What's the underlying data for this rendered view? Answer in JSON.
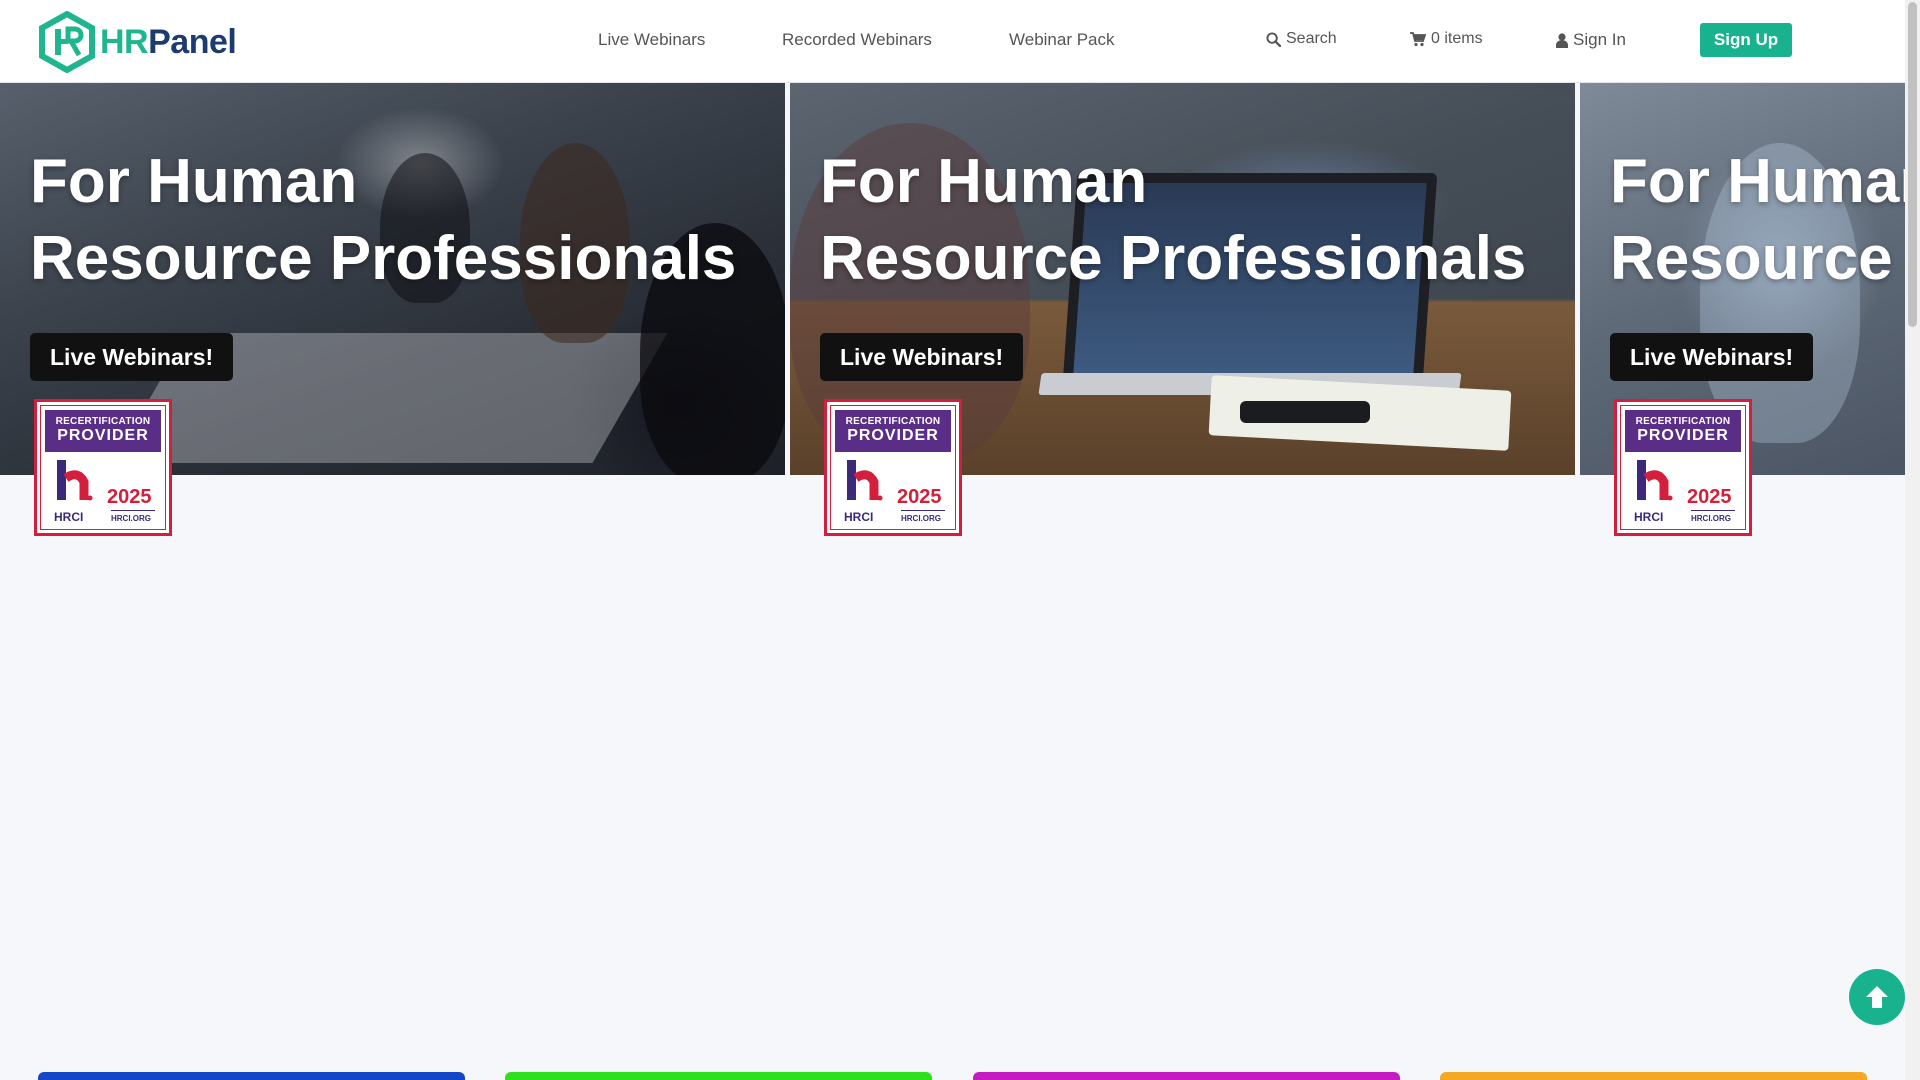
{
  "brand": {
    "logo_hr": "HR",
    "logo_panel": "Panel"
  },
  "nav": {
    "links": [
      "Live Webinars",
      "Recorded Webinars",
      "Webinar Pack"
    ],
    "search_label": "Search",
    "cart_label": "0 items",
    "signin_label": "Sign In",
    "signup_label": "Sign Up"
  },
  "slides": [
    {
      "title_line1": "For Human",
      "title_line2": "Resource Professionals",
      "button": "Live Webinars!"
    },
    {
      "title_line1": "For Human",
      "title_line2": "Resource Professionals",
      "button": "Live Webinars!"
    },
    {
      "title_line1": "For Human",
      "title_line2": "Resource Professionals",
      "button": "Live Webinars!"
    }
  ],
  "badge": {
    "line1": "RECERTIFICATION",
    "line2": "PROVIDER",
    "org": "HRCI",
    "year": "2025",
    "url": "HRCI.ORG"
  },
  "icons": {
    "search": "search-icon",
    "cart": "cart-icon",
    "user": "user-icon",
    "back_to_top": "arrow-up-circle-icon"
  },
  "colors": {
    "accent": "#18b38e",
    "brand_navy": "#1c3b6e",
    "badge_purple": "#5a2d87",
    "badge_red": "#d31f3d",
    "category_bars": [
      "#1446c8",
      "#2ee01e",
      "#c61bc2",
      "#f5a824"
    ]
  }
}
